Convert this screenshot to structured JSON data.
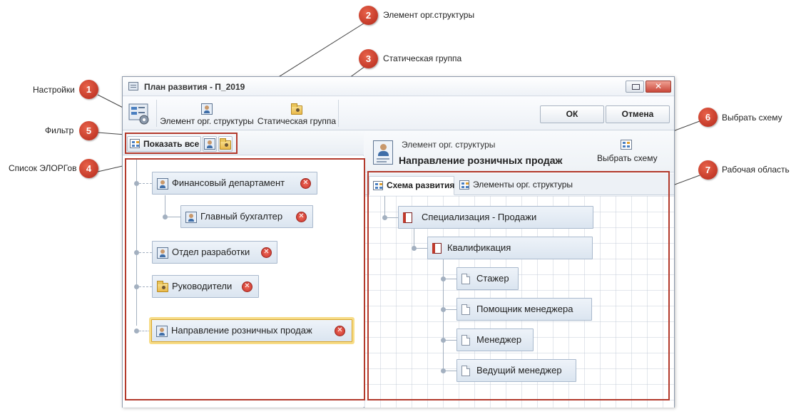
{
  "window": {
    "title": "План развития - П_2019",
    "close_glyph": "✕"
  },
  "toolbar": {
    "settings_icon": "settings-gear-icon",
    "org_element_label": "Элемент орг. структуры",
    "static_group_label": "Статическая группа",
    "ok_label": "ОК",
    "cancel_label": "Отмена"
  },
  "filter": {
    "show_all_label": "Показать все"
  },
  "org_list": [
    {
      "label": "Финансовый департамент",
      "icon": "org-element-icon",
      "level": 0
    },
    {
      "label": "Главный бухгалтер",
      "icon": "org-element-icon",
      "level": 1
    },
    {
      "label": "Отдел разработки",
      "icon": "org-element-icon",
      "level": 0
    },
    {
      "label": "Руководители",
      "icon": "static-group-icon",
      "level": 0
    },
    {
      "label": "Направление розничных продаж",
      "icon": "org-element-icon",
      "level": 0,
      "selected": true
    }
  ],
  "element_header": {
    "caption": "Элемент орг. структуры",
    "name": "Направление розничных продаж",
    "choose_scheme_label": "Выбрать схему"
  },
  "tabs": [
    {
      "label": "Схема развития",
      "active": true
    },
    {
      "label": "Элементы орг. структуры",
      "active": false
    }
  ],
  "scheme": {
    "specialization": "Специализация - Продажи",
    "qualification": "Квалификация",
    "positions": [
      "Стажер",
      "Помощник менеджера",
      "Менеджер",
      "Ведущий менеджер"
    ]
  },
  "callouts": [
    {
      "num": "1",
      "label": "Настройки"
    },
    {
      "num": "2",
      "label": "Элемент орг.структуры"
    },
    {
      "num": "3",
      "label": "Статическая группа"
    },
    {
      "num": "4",
      "label": "Список ЭЛОРГов"
    },
    {
      "num": "5",
      "label": "Фильтр"
    },
    {
      "num": "6",
      "label": "Выбрать схему"
    },
    {
      "num": "7",
      "label": "Рабочая область"
    }
  ],
  "colors": {
    "callout": "#c0392b",
    "highlight": "#b33a2c",
    "node_border": "#a9b9cd",
    "selected_outline": "#f7dc86"
  }
}
